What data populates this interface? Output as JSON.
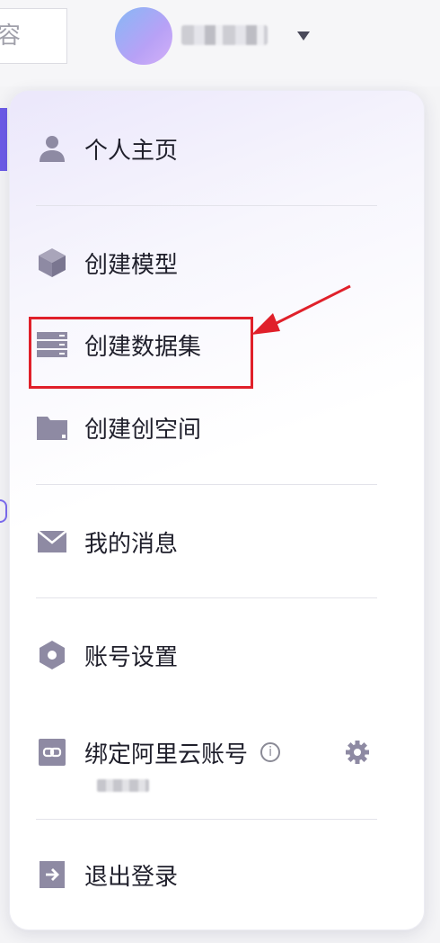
{
  "topbar": {
    "search_placeholder": "容",
    "dropdown_caret": "chevron-down-icon"
  },
  "menu": {
    "items": [
      {
        "label": "个人主页",
        "icon": "user-icon"
      },
      {
        "label": "创建模型",
        "icon": "cube-icon"
      },
      {
        "label": "创建数据集",
        "icon": "server-icon",
        "highlighted": true
      },
      {
        "label": "创建创空间",
        "icon": "folder-icon"
      },
      {
        "label": "我的消息",
        "icon": "mail-icon"
      },
      {
        "label": "账号设置",
        "icon": "hexagon-icon"
      },
      {
        "label": "绑定阿里云账号",
        "icon": "link-icon",
        "info_icon": "info-icon",
        "settings_icon": "gear-icon"
      },
      {
        "label": "退出登录",
        "icon": "logout-icon"
      }
    ],
    "info_glyph": "i"
  },
  "colors": {
    "icon": "#8e8aa3",
    "highlight_border": "#e0202a",
    "arrow": "#e0202a"
  }
}
